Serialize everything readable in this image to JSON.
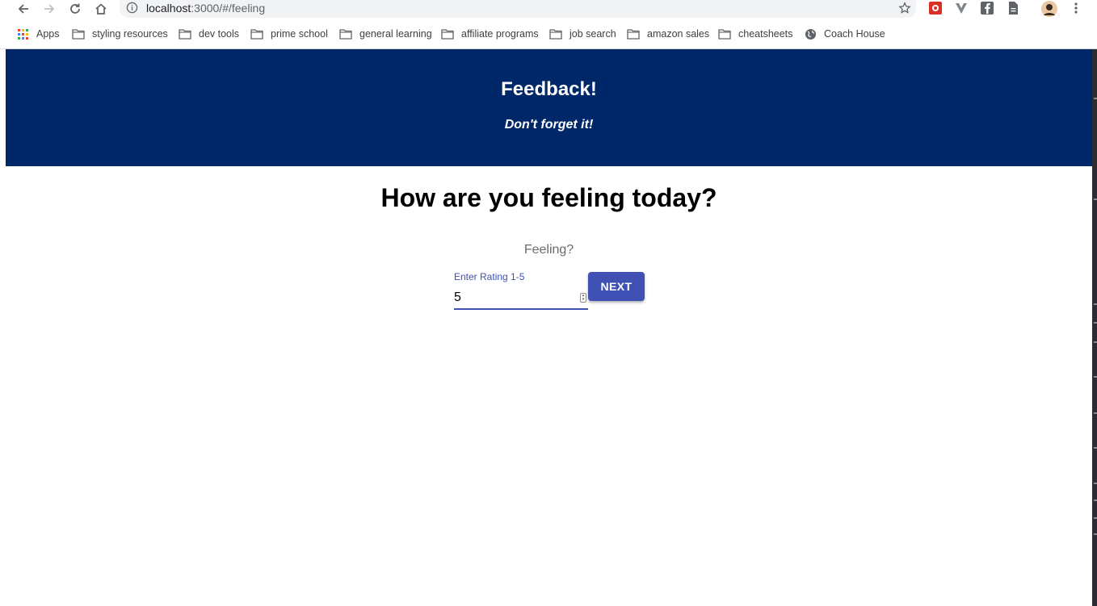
{
  "browser": {
    "url_host": "localhost",
    "url_path": ":3000/#/feeling",
    "bookmarks": [
      {
        "label": "Apps",
        "icon": "apps-grid-icon"
      },
      {
        "label": "styling resources",
        "icon": "folder-icon"
      },
      {
        "label": "dev tools",
        "icon": "folder-icon"
      },
      {
        "label": "prime school",
        "icon": "folder-icon"
      },
      {
        "label": "general learning",
        "icon": "folder-icon"
      },
      {
        "label": "affiliate programs",
        "icon": "folder-icon"
      },
      {
        "label": "job search",
        "icon": "folder-icon"
      },
      {
        "label": "amazon sales",
        "icon": "folder-icon"
      },
      {
        "label": "cheatsheets",
        "icon": "folder-icon"
      },
      {
        "label": "Coach House",
        "icon": "globe-icon"
      }
    ]
  },
  "header": {
    "title": "Feedback!",
    "subtitle": "Don't forget it!",
    "background": "#002868"
  },
  "main": {
    "question": "How are you feeling today?",
    "section_label": "Feeling?",
    "rating_field": {
      "label": "Enter Rating 1-5",
      "value": "5"
    },
    "next_button": "NEXT",
    "accent": "#3f51b5"
  }
}
